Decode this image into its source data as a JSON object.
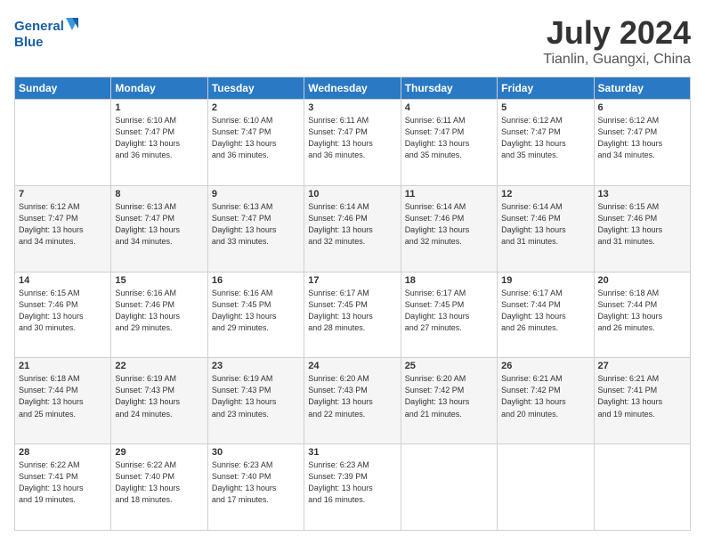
{
  "header": {
    "logo_line1": "General",
    "logo_line2": "Blue",
    "title": "July 2024",
    "subtitle": "Tianlin, Guangxi, China"
  },
  "days_of_week": [
    "Sunday",
    "Monday",
    "Tuesday",
    "Wednesday",
    "Thursday",
    "Friday",
    "Saturday"
  ],
  "weeks": [
    [
      {
        "day": "",
        "info": ""
      },
      {
        "day": "1",
        "info": "Sunrise: 6:10 AM\nSunset: 7:47 PM\nDaylight: 13 hours\nand 36 minutes."
      },
      {
        "day": "2",
        "info": "Sunrise: 6:10 AM\nSunset: 7:47 PM\nDaylight: 13 hours\nand 36 minutes."
      },
      {
        "day": "3",
        "info": "Sunrise: 6:11 AM\nSunset: 7:47 PM\nDaylight: 13 hours\nand 36 minutes."
      },
      {
        "day": "4",
        "info": "Sunrise: 6:11 AM\nSunset: 7:47 PM\nDaylight: 13 hours\nand 35 minutes."
      },
      {
        "day": "5",
        "info": "Sunrise: 6:12 AM\nSunset: 7:47 PM\nDaylight: 13 hours\nand 35 minutes."
      },
      {
        "day": "6",
        "info": "Sunrise: 6:12 AM\nSunset: 7:47 PM\nDaylight: 13 hours\nand 34 minutes."
      }
    ],
    [
      {
        "day": "7",
        "info": "Sunrise: 6:12 AM\nSunset: 7:47 PM\nDaylight: 13 hours\nand 34 minutes."
      },
      {
        "day": "8",
        "info": "Sunrise: 6:13 AM\nSunset: 7:47 PM\nDaylight: 13 hours\nand 34 minutes."
      },
      {
        "day": "9",
        "info": "Sunrise: 6:13 AM\nSunset: 7:47 PM\nDaylight: 13 hours\nand 33 minutes."
      },
      {
        "day": "10",
        "info": "Sunrise: 6:14 AM\nSunset: 7:46 PM\nDaylight: 13 hours\nand 32 minutes."
      },
      {
        "day": "11",
        "info": "Sunrise: 6:14 AM\nSunset: 7:46 PM\nDaylight: 13 hours\nand 32 minutes."
      },
      {
        "day": "12",
        "info": "Sunrise: 6:14 AM\nSunset: 7:46 PM\nDaylight: 13 hours\nand 31 minutes."
      },
      {
        "day": "13",
        "info": "Sunrise: 6:15 AM\nSunset: 7:46 PM\nDaylight: 13 hours\nand 31 minutes."
      }
    ],
    [
      {
        "day": "14",
        "info": "Sunrise: 6:15 AM\nSunset: 7:46 PM\nDaylight: 13 hours\nand 30 minutes."
      },
      {
        "day": "15",
        "info": "Sunrise: 6:16 AM\nSunset: 7:46 PM\nDaylight: 13 hours\nand 29 minutes."
      },
      {
        "day": "16",
        "info": "Sunrise: 6:16 AM\nSunset: 7:45 PM\nDaylight: 13 hours\nand 29 minutes."
      },
      {
        "day": "17",
        "info": "Sunrise: 6:17 AM\nSunset: 7:45 PM\nDaylight: 13 hours\nand 28 minutes."
      },
      {
        "day": "18",
        "info": "Sunrise: 6:17 AM\nSunset: 7:45 PM\nDaylight: 13 hours\nand 27 minutes."
      },
      {
        "day": "19",
        "info": "Sunrise: 6:17 AM\nSunset: 7:44 PM\nDaylight: 13 hours\nand 26 minutes."
      },
      {
        "day": "20",
        "info": "Sunrise: 6:18 AM\nSunset: 7:44 PM\nDaylight: 13 hours\nand 26 minutes."
      }
    ],
    [
      {
        "day": "21",
        "info": "Sunrise: 6:18 AM\nSunset: 7:44 PM\nDaylight: 13 hours\nand 25 minutes."
      },
      {
        "day": "22",
        "info": "Sunrise: 6:19 AM\nSunset: 7:43 PM\nDaylight: 13 hours\nand 24 minutes."
      },
      {
        "day": "23",
        "info": "Sunrise: 6:19 AM\nSunset: 7:43 PM\nDaylight: 13 hours\nand 23 minutes."
      },
      {
        "day": "24",
        "info": "Sunrise: 6:20 AM\nSunset: 7:43 PM\nDaylight: 13 hours\nand 22 minutes."
      },
      {
        "day": "25",
        "info": "Sunrise: 6:20 AM\nSunset: 7:42 PM\nDaylight: 13 hours\nand 21 minutes."
      },
      {
        "day": "26",
        "info": "Sunrise: 6:21 AM\nSunset: 7:42 PM\nDaylight: 13 hours\nand 20 minutes."
      },
      {
        "day": "27",
        "info": "Sunrise: 6:21 AM\nSunset: 7:41 PM\nDaylight: 13 hours\nand 19 minutes."
      }
    ],
    [
      {
        "day": "28",
        "info": "Sunrise: 6:22 AM\nSunset: 7:41 PM\nDaylight: 13 hours\nand 19 minutes."
      },
      {
        "day": "29",
        "info": "Sunrise: 6:22 AM\nSunset: 7:40 PM\nDaylight: 13 hours\nand 18 minutes."
      },
      {
        "day": "30",
        "info": "Sunrise: 6:23 AM\nSunset: 7:40 PM\nDaylight: 13 hours\nand 17 minutes."
      },
      {
        "day": "31",
        "info": "Sunrise: 6:23 AM\nSunset: 7:39 PM\nDaylight: 13 hours\nand 16 minutes."
      },
      {
        "day": "",
        "info": ""
      },
      {
        "day": "",
        "info": ""
      },
      {
        "day": "",
        "info": ""
      }
    ]
  ]
}
